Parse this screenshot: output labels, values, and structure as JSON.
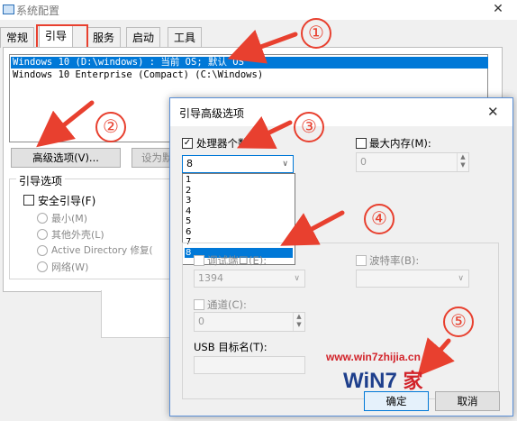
{
  "main_window": {
    "title": "系统配置",
    "tabs": [
      {
        "label": "常规"
      },
      {
        "label": "引导"
      },
      {
        "label": "服务"
      },
      {
        "label": "启动"
      },
      {
        "label": "工具"
      }
    ],
    "boot_entries": [
      "Windows 10 (D:\\windows) : 当前 OS; 默认 OS",
      "Windows 10 Enterprise (Compact) (C:\\Windows)"
    ],
    "advanced_button": "高级选项(V)...",
    "default_button": "设为默",
    "boot_options": {
      "group_label": "引导选项",
      "safe_boot": "安全引导(F)",
      "minimal": "最小(M)",
      "alternate_shell": "其他外壳(L)",
      "active_directory": "Active Directory 修复(",
      "network": "网络(W)"
    }
  },
  "dialog": {
    "title": "引导高级选项",
    "processor_count_label": "处理器个数(N):",
    "processor_count_value": "8",
    "processor_options": [
      "1",
      "2",
      "3",
      "4",
      "5",
      "6",
      "7",
      "8"
    ],
    "max_memory_label": "最大内存(M):",
    "max_memory_value": "0",
    "debug_port_label": "调试端口(E):",
    "debug_port_value": "1394",
    "baud_rate_label": "波特率(B):",
    "channel_label": "通道(C):",
    "channel_value": "0",
    "usb_target_label": "USB 目标名(T):",
    "ok_button": "确定",
    "cancel_button": "取消"
  },
  "annotations": [
    "①",
    "②",
    "③",
    "④",
    "⑤"
  ],
  "watermark": {
    "url": "www.win7zhijia.cn",
    "logo": "WiN7",
    "logo_suffix": "家"
  },
  "colors": {
    "selection": "#0078d7",
    "annotation": "#e8402f",
    "watermark_red": "#d2232a",
    "watermark_blue": "#1e3f8c"
  }
}
